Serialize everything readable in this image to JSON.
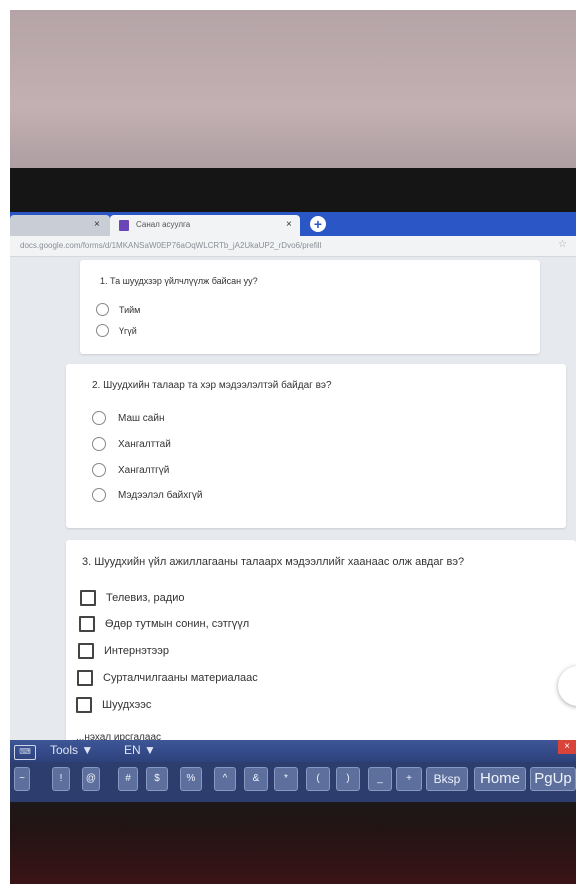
{
  "browser": {
    "inactive_tab_close": "×",
    "active_tab_title": "Санал асуулга",
    "active_tab_close": "×",
    "new_tab": "+",
    "url": "docs.google.com/forms/d/1MKANSaW0EP76aOqWLCRTb_jA2UkaUP2_rDvo6/prefill",
    "star": "☆"
  },
  "form": {
    "q1": {
      "title": "1. Та шуудхзэр үйлчлүүлж байсан уу?",
      "options": [
        "Тийм",
        "Үгүй"
      ]
    },
    "q2": {
      "title": "2. Шуудхийн талаар та хэр мэдээлэлтэй байдаг вэ?",
      "options": [
        "Маш сайн",
        "Хангалттай",
        "Хангалтгүй",
        "Мэдээлэл байхгүй"
      ]
    },
    "q3": {
      "title": "3. Шуудхийн үйл ажиллагааны талаарх мэдээллийг хаанаас олж авдаг вэ?",
      "options": [
        "Телевиз, радио",
        "Өдөр тутмын сонин, сэтгүүл",
        "Интернэтээр",
        "Сурталчилгааны материалаас",
        "Шуудхээс"
      ],
      "partial_option": "...нэхал ирсгалаас"
    }
  },
  "osk": {
    "tools": "Tools",
    "tools_arrow": "▼",
    "lang": "EN",
    "lang_arrow": "▼",
    "close": "×",
    "keys": [
      "~",
      "!",
      "@",
      "#",
      "$",
      "%",
      "^",
      "&",
      "*",
      "(",
      ")",
      "_",
      "+",
      "Bksp",
      "Home",
      "PgUp"
    ]
  }
}
